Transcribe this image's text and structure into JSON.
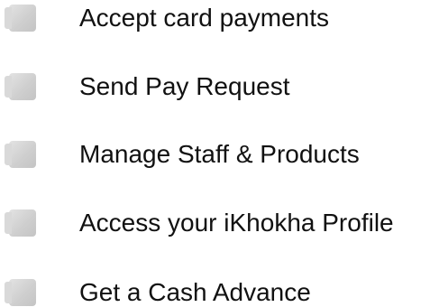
{
  "menu": {
    "items": [
      {
        "label": "Accept card payments",
        "icon": "card-payment-icon"
      },
      {
        "label": "Send Pay Request",
        "icon": "pay-request-icon"
      },
      {
        "label": "Manage Staff & Products",
        "icon": "staff-products-icon"
      },
      {
        "label": "Access your iKhokha Profile",
        "icon": "profile-icon"
      },
      {
        "label": "Get a Cash Advance",
        "icon": "cash-advance-icon"
      }
    ]
  },
  "colors": {
    "text": "#111111",
    "bullet": "#cfcfcf",
    "background": "#ffffff"
  }
}
